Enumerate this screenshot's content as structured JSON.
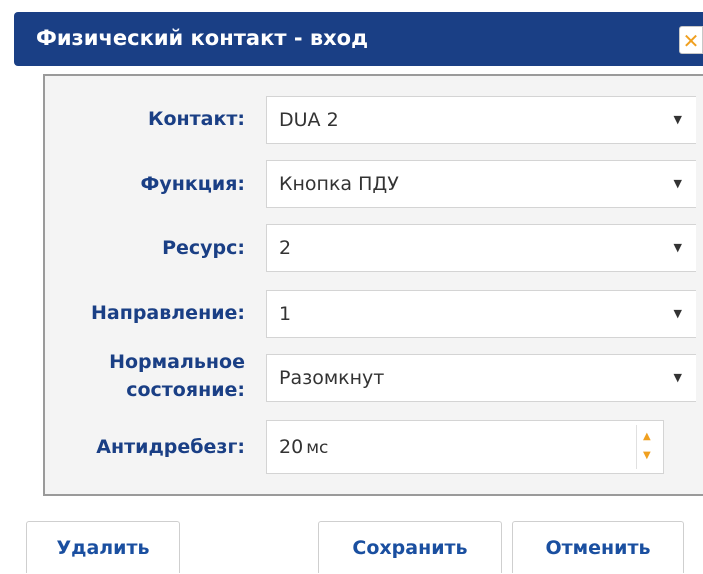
{
  "dialog": {
    "title": "Физический контакт - вход",
    "close_icon": "close-icon"
  },
  "form": {
    "contact": {
      "label": "Контакт:",
      "value": "DUA 2"
    },
    "function": {
      "label": "Функция:",
      "value": "Кнопка ПДУ"
    },
    "resource": {
      "label": "Ресурс:",
      "value": "2"
    },
    "direction": {
      "label": "Направление:",
      "value": "1"
    },
    "normal_state": {
      "label_line1": "Нормальное",
      "label_line2": "состояние:",
      "value": "Разомкнут"
    },
    "debounce": {
      "label": "Антидребезг:",
      "value": "20",
      "unit": "мс"
    }
  },
  "buttons": {
    "delete": "Удалить",
    "save": "Сохранить",
    "cancel": "Отменить"
  },
  "colors": {
    "title_bar": "#1a3f85",
    "label": "#1a3f85",
    "accent": "#f0a020"
  }
}
